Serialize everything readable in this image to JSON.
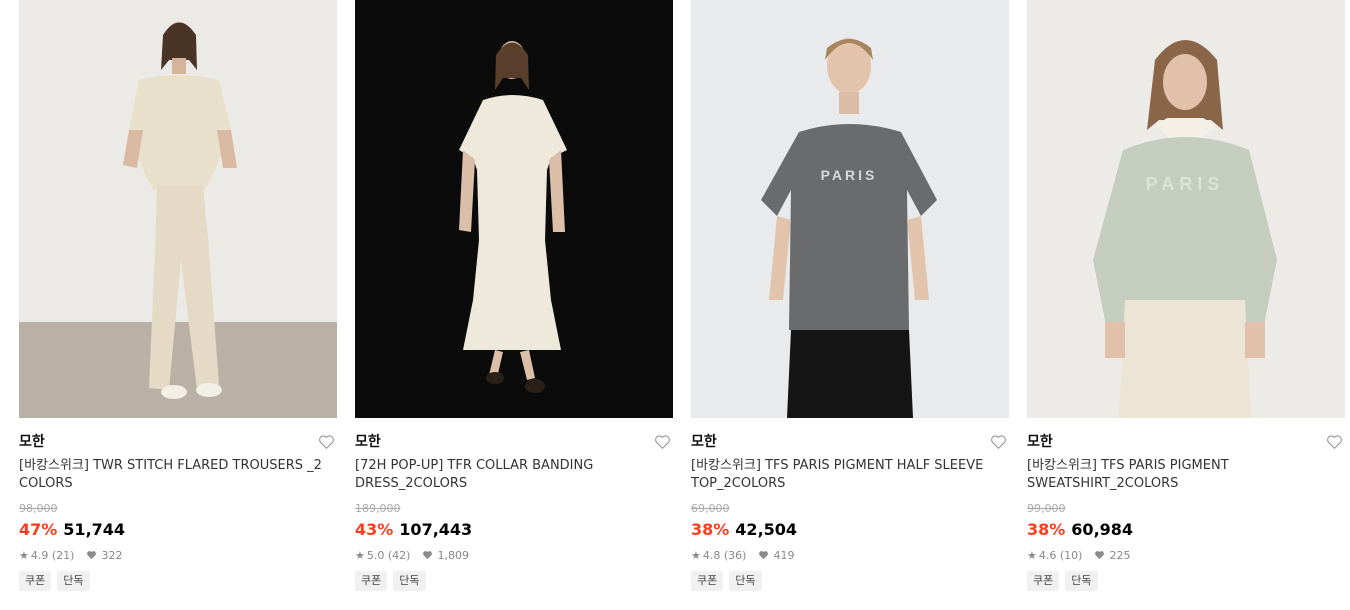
{
  "products": [
    {
      "brand": "모한",
      "name": "[바캉스위크] TWR STITCH FLARED TROUSERS _2 COLORS",
      "original_price": "98,000",
      "discount": "47%",
      "price": "51,744",
      "rating": "4.9",
      "reviews": "(21)",
      "likes": "322",
      "tags": [
        "쿠폰",
        "단독"
      ],
      "bg": "#ebe9e6",
      "floor": "#b8b0a4",
      "garment": "#e9e0cc",
      "pants": "#e4dac6"
    },
    {
      "brand": "모한",
      "name": "[72H POP-UP] TFR COLLAR BANDING DRESS_2COLORS",
      "original_price": "189,000",
      "discount": "43%",
      "price": "107,443",
      "rating": "5.0",
      "reviews": "(42)",
      "likes": "1,809",
      "tags": [
        "쿠폰",
        "단독"
      ],
      "bg": "#0b0b0b",
      "garment": "#efe9dc"
    },
    {
      "brand": "모한",
      "name": "[바캉스위크] TFS PARIS PIGMENT HALF SLEEVE TOP_2COLORS",
      "original_price": "69,000",
      "discount": "38%",
      "price": "42,504",
      "rating": "4.8",
      "reviews": "(36)",
      "likes": "419",
      "tags": [
        "쿠폰",
        "단독"
      ],
      "bg": "#e9eaeb",
      "garment": "#6a6b6d",
      "skirt": "#151515"
    },
    {
      "brand": "모한",
      "name": "[바캉스위크] TFS PARIS PIGMENT SWEATSHIRT_2COLORS",
      "original_price": "99,000",
      "discount": "38%",
      "price": "60,984",
      "rating": "4.6",
      "reviews": "(10)",
      "likes": "225",
      "tags": [
        "쿠폰",
        "단독"
      ],
      "bg": "#ecebe8",
      "garment": "#c5cdbf",
      "skirt": "#ece5d6"
    }
  ],
  "icons": {
    "wishlist": "heart-outline-icon",
    "rating": "star-icon",
    "likes": "heart-filled-icon"
  },
  "colors": {
    "discount": "#ff3b1f",
    "tag_bg": "#f1f1f1"
  }
}
